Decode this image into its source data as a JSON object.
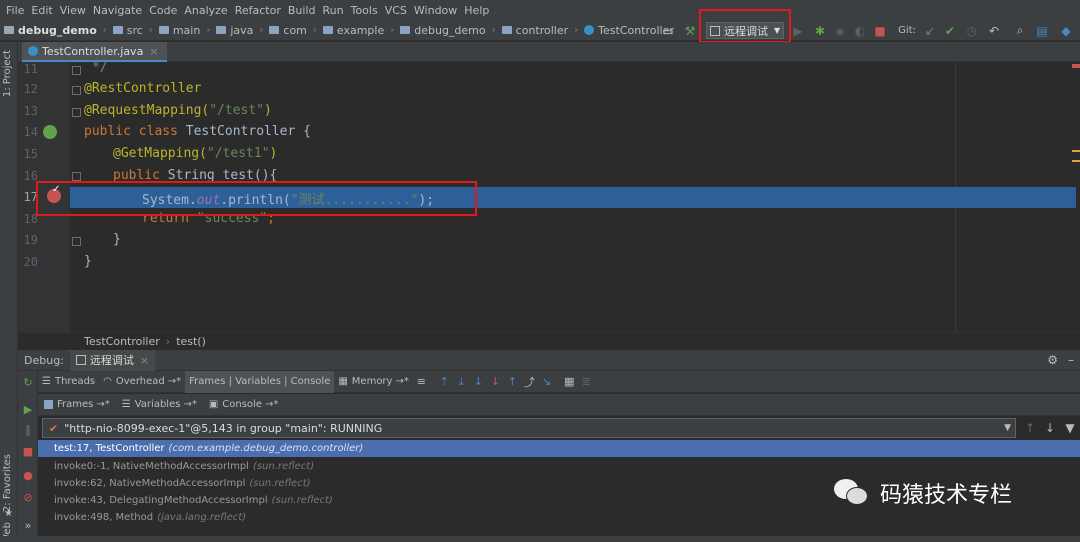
{
  "menu": [
    "File",
    "Edit",
    "View",
    "Navigate",
    "Code",
    "Analyze",
    "Refactor",
    "Build",
    "Run",
    "Tools",
    "VCS",
    "Window",
    "Help"
  ],
  "breadcrumbs": [
    "debug_demo",
    "src",
    "main",
    "java",
    "com",
    "example",
    "debug_demo",
    "controller",
    "TestController"
  ],
  "run_config": "远程调试",
  "git_label": "Git:",
  "tab": {
    "filename": "TestController.java"
  },
  "left_stripe": {
    "project": "1: Project",
    "favorites": "2: Favorites",
    "web": "Web"
  },
  "editor": {
    "lines": [
      {
        "n": "11",
        "text": "*/"
      },
      {
        "n": "12",
        "text": "@RestController"
      },
      {
        "n": "13",
        "text": "@RequestMapping(\"/test\")"
      },
      {
        "n": "14",
        "text": "public class TestController {"
      },
      {
        "n": "15",
        "text": "@GetMapping(\"/test1\")"
      },
      {
        "n": "16",
        "text": "public String test(){"
      },
      {
        "n": "17",
        "text": "System.out.println(\"测试...........\");"
      },
      {
        "n": "18",
        "text": "return \"success\";"
      },
      {
        "n": "19",
        "text": "}"
      },
      {
        "n": "20",
        "text": "}"
      }
    ],
    "tokens": {
      "l12": "@RestController",
      "l13a": "@RequestMapping(",
      "l13b": "\"/test\"",
      "l13c": ")",
      "l14a": "public class ",
      "l14b": "TestController {",
      "l15a": "@GetMapping(",
      "l15b": "\"/test1\"",
      "l15c": ")",
      "l16a": "public ",
      "l16b": "String test(){",
      "l17a": "System.",
      "l17b": "out",
      "l17c": ".println(",
      "l17d": "\"测试...........\"",
      "l17e": ");",
      "l18a": "return ",
      "l18b": "\"success\"",
      "l18c": ";",
      "l19": "}",
      "l20": "}",
      "l11": "*/"
    }
  },
  "editor_breadcrumb": {
    "class": "TestController",
    "method": "test()"
  },
  "debug": {
    "label": "Debug:",
    "session_tab": "远程调试",
    "toolbar": {
      "threads": "Threads",
      "overhead": "Overhead",
      "frames_vars_console": "Frames | Variables | Console",
      "memory": "Memory"
    },
    "subtabs": {
      "frames": "Frames",
      "variables": "Variables",
      "console": "Console"
    },
    "thread": "\"http-nio-8099-exec-1\"@5,143 in group \"main\": RUNNING",
    "frames": [
      {
        "method": "test:17, TestController",
        "pkg": "(com.example.debug_demo.controller)"
      },
      {
        "method": "invoke0:-1, NativeMethodAccessorImpl",
        "pkg": "(sun.reflect)"
      },
      {
        "method": "invoke:62, NativeMethodAccessorImpl",
        "pkg": "(sun.reflect)"
      },
      {
        "method": "invoke:43, DelegatingMethodAccessorImpl",
        "pkg": "(sun.reflect)"
      },
      {
        "method": "invoke:498, Method",
        "pkg": "(java.lang.reflect)"
      }
    ]
  },
  "watermark": "码猿技术专栏",
  "colors": {
    "accent": "#4a88c7",
    "highlight_line": "#2d6099",
    "selected_frame": "#4b6eaf",
    "annotation_box": "#e0191b"
  }
}
